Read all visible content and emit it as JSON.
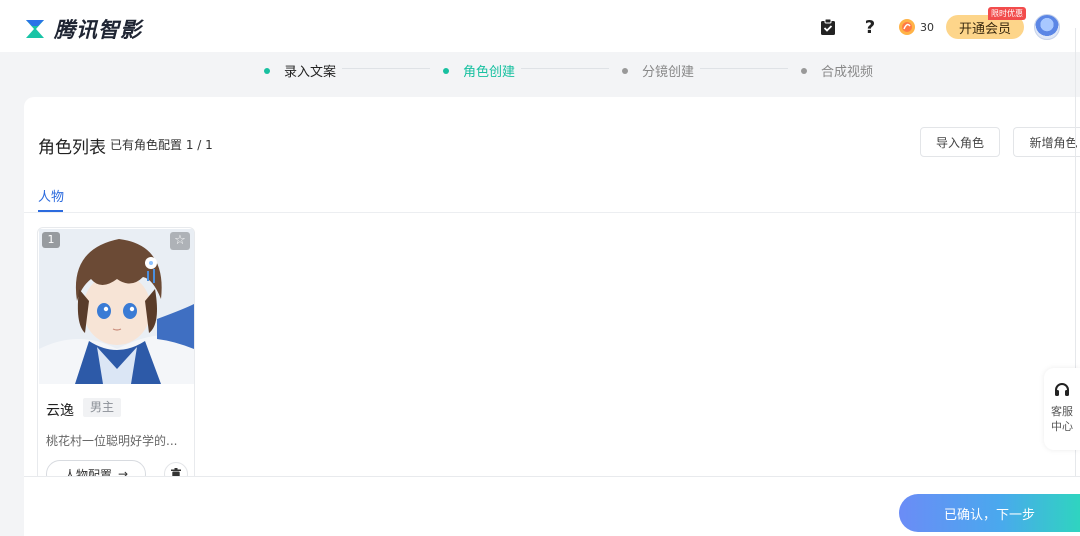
{
  "header": {
    "logo_text": "腾讯智影",
    "coins": "30",
    "vip_label": "开通会员",
    "vip_badge": "限时优惠"
  },
  "steps": [
    {
      "label": "录入文案",
      "state": "done"
    },
    {
      "label": "角色创建",
      "state": "active"
    },
    {
      "label": "分镜创建",
      "state": "todo"
    },
    {
      "label": "合成视频",
      "state": "todo"
    }
  ],
  "panel": {
    "title": "角色列表",
    "count_label": "已有角色配置 1 / 1",
    "import_button": "导入角色",
    "add_button": "新增角色",
    "tabs": [
      {
        "label": "人物"
      }
    ]
  },
  "character_card": {
    "index": "1",
    "name": "云逸",
    "tag": "男主",
    "description": "桃花村一位聪明好学的...",
    "config_button": "人物配置"
  },
  "footer": {
    "next_button": "已确认，下一步"
  },
  "service": {
    "label": "客服中心"
  },
  "colors": {
    "accent_green": "#18c0a0",
    "accent_blue": "#2c6bde",
    "vip": "#fdd58a"
  }
}
